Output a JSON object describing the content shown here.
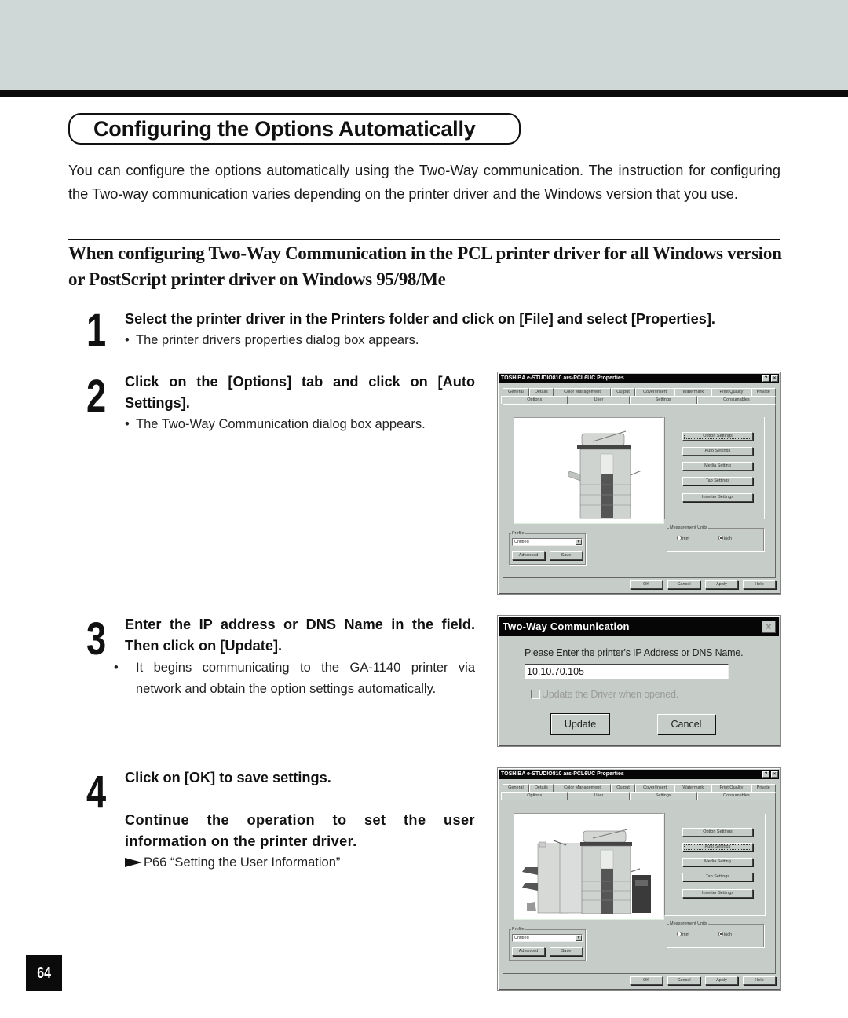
{
  "page": {
    "title": "Configuring the Options Automatically",
    "intro": "You can configure the options automatically using the Two-Way communication.  The instruction for configuring the Two-way communication varies depending on the printer driver and the Windows version that you use.",
    "section_heading": "When configuring Two-Way Communication in the PCL printer driver for all Windows version or PostScript printer driver on Windows 95/98/Me",
    "page_number": "64"
  },
  "steps": [
    {
      "number": "1",
      "heading": "Select the printer driver in the Printers folder and click on [File] and select [Properties].",
      "bullet": "The printer drivers properties dialog box appears."
    },
    {
      "number": "2",
      "heading": "Click on the [Options] tab and click on [Auto Settings].",
      "bullet": "The Two-Way Communication dialog box appears."
    },
    {
      "number": "3",
      "heading": "Enter the IP address or DNS Name in the field. Then click on [Update].",
      "bullet": "It begins communicating to the GA-1140 printer via network and obtain the option settings automatically."
    },
    {
      "number": "4",
      "heading": "Click on [OK] to save settings.",
      "heading2": "Continue the operation to set the user information on the printer driver.",
      "reference": "P66 “Setting the User Information”"
    }
  ],
  "bullet_char": "•",
  "properties_dialog": {
    "title": "TOSHIBA e-STUDIO810 ars-PCL6UC Properties",
    "help_btn": "?",
    "close_btn": "×",
    "tabs_back": [
      "General",
      "Details",
      "Color Management",
      "Output",
      "Cover/Insert",
      "Watermark",
      "Print Quality",
      "Private"
    ],
    "tabs_front": [
      "Options",
      "User",
      "Settings",
      "Consumables"
    ],
    "active_tab": "Options",
    "side_buttons": [
      "Option Settings",
      "Auto Settings",
      "Media Setting",
      "Tab Settings",
      "Inserter Settings"
    ],
    "profile_label": "Profile",
    "profile_value": "Untitled",
    "advanced_btn": "Advanced",
    "save_btn": "Save",
    "measurement_label": "Measurement Units",
    "unit_mm": "mm",
    "unit_inch": "inch",
    "selected_unit": "inch",
    "footer_buttons": [
      "OK",
      "Cancel",
      "Apply",
      "Help"
    ],
    "dropdown_arrow": "▼"
  },
  "two_way_dialog": {
    "title": "Two-Way Communication",
    "close_btn": "×",
    "prompt": "Please Enter the printer's IP Address or DNS Name.",
    "ip_value": "10.10.70.105",
    "checkbox_label": "Update the Driver when opened.",
    "checkbox_checked": false,
    "update_btn": "Update",
    "cancel_btn": "Cancel"
  },
  "colors": {
    "header_band": "#cfd8d7",
    "dialog_face": "#c6cdc9",
    "title_bar": "#060606"
  }
}
